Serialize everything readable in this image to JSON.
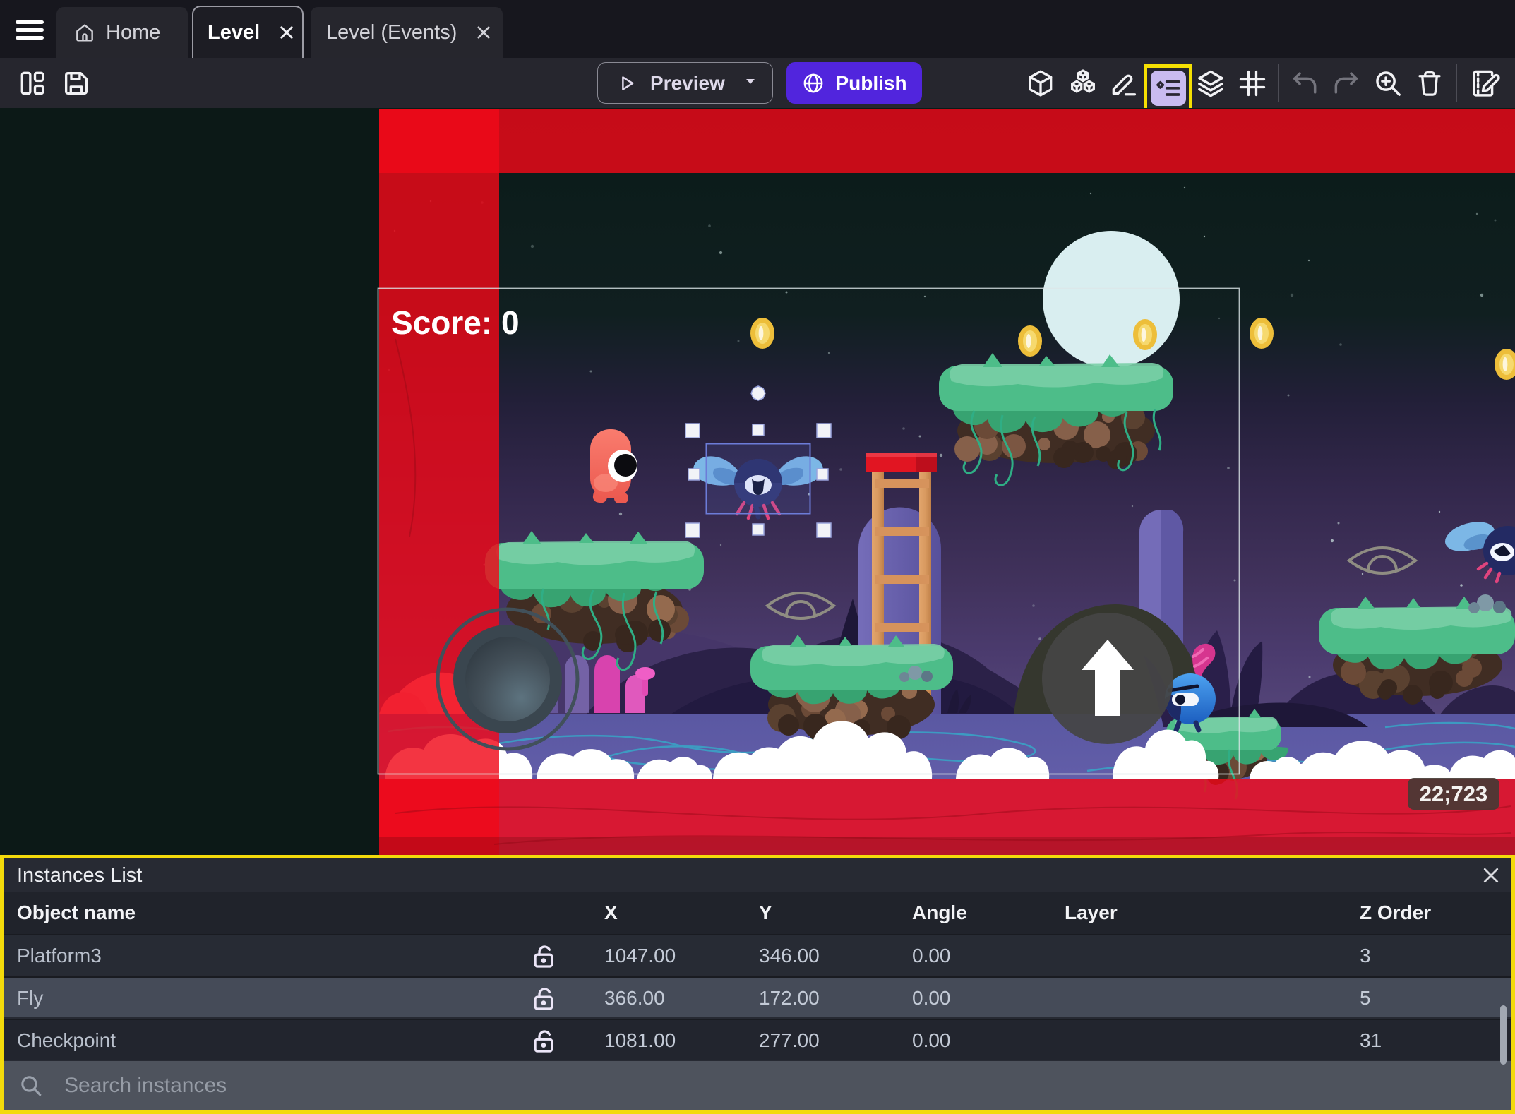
{
  "colors": {
    "highlight_yellow": "#f3da0b",
    "publish_purple": "#5125dd",
    "active_tool_bg": "#c9bbf0",
    "scene_wall_red": "#ea0717",
    "selected_row_bg": "#454b58"
  },
  "tabbar": {
    "tabs": [
      {
        "label": "Home",
        "active": false,
        "closable": false
      },
      {
        "label": "Level",
        "active": true,
        "closable": true
      },
      {
        "label": "Level (Events)",
        "active": false,
        "closable": true
      }
    ]
  },
  "toolbar": {
    "preview_label": "Preview",
    "publish_label": "Publish",
    "active_tool": "instances-list"
  },
  "scene": {
    "score_text": "Score: 0",
    "coordinates_badge": "22;723"
  },
  "panel": {
    "title": "Instances List",
    "columns": [
      "Object name",
      "X",
      "Y",
      "Angle",
      "Layer",
      "Z Order"
    ],
    "rows": [
      {
        "name": "Platform3",
        "x": "1047.00",
        "y": "346.00",
        "angle": "0.00",
        "layer": "",
        "z": "3",
        "selected": false
      },
      {
        "name": "Fly",
        "x": "366.00",
        "y": "172.00",
        "angle": "0.00",
        "layer": "",
        "z": "5",
        "selected": true
      },
      {
        "name": "Checkpoint",
        "x": "1081.00",
        "y": "277.00",
        "angle": "0.00",
        "layer": "",
        "z": "31",
        "selected": false
      }
    ],
    "search_placeholder": "Search instances"
  }
}
